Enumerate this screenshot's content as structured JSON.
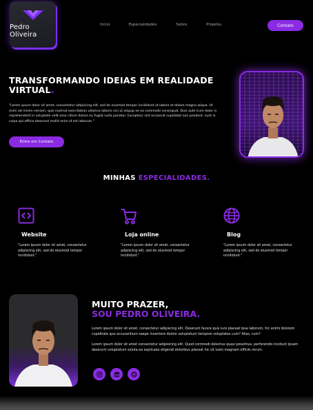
{
  "header": {
    "logo_text": "Pedro Oliveira",
    "nav": [
      "Início",
      "Especialidades",
      "Sobre",
      "Projetos"
    ],
    "contact_label": "Contato"
  },
  "hero": {
    "title_line1": "TRANSFORMANDO IDEIAS EM REALIDADE",
    "title_line2": "VIRTUAL",
    "title_dot": ".",
    "text": "\"Lorem ipsum dolor sit amet, consectetur adipiscing elit, sed do eiusmod tempor incididunt ut labore et dolore magna aliqua. Ut enim ad minim veniam, quis nostrud exercitation ullamco laboris nisi ut aliquip ex ea commodo consequat. Duis aute irure dolor in reprehenderit in voluptate velit esse cillum dolore eu fugiat nulla pariatur. Excepteur sint occaecat cupidatat non proident, sunt in culpa qui officia deserunt mollit anim id est laborum.\"",
    "button_label": "Entre em Contato"
  },
  "specialties": {
    "title_white": "MINHAS ",
    "title_purple": "ESPECIALIDADES.",
    "items": [
      {
        "label": "Website",
        "icon": "code-icon",
        "text": "\"Lorem ipsum dolor sit amet, consectetur adipiscing elit, sed do eiusmod tempor incididunt.\""
      },
      {
        "label": "Loja online",
        "icon": "cart-icon",
        "text": "\"Lorem ipsum dolor sit amet, consectetur adipiscing elit, sed do eiusmod tempor incididunt.\""
      },
      {
        "label": "Blog",
        "icon": "globe-icon",
        "text": "\"Lorem ipsum dolor sit amet, consectetur adipiscing elit, sed do eiusmod tempor incididunt.\""
      }
    ]
  },
  "about": {
    "title_line1": "MUITO PRAZER,",
    "title_line2": "SOU PEDRO OLIVEIRA.",
    "p1": "Lorem ipsum dolor sit amet, consectetur adipiscing elit. Deserunt facere quis iure placeat ipsa laborum, hic animi dolorem cupiditate quo accusantium saepe inventore dolore voluptatum tempore voluptates cum? Alias, cum?",
    "p2": "Lorem ipsum dolor sit amet consectetur adipisicing elit. Quod commodi delectus quasi possimus, perferendis incidunt ipsam deserunt voluptatum soluta ea explicabo eligendi doloribus placeat hic sit iusto magnam officiis rerum.",
    "socials": [
      "instagram-icon",
      "linkedin-icon",
      "github-icon"
    ]
  },
  "colors": {
    "accent": "#8a2be2",
    "background": "#000000"
  }
}
